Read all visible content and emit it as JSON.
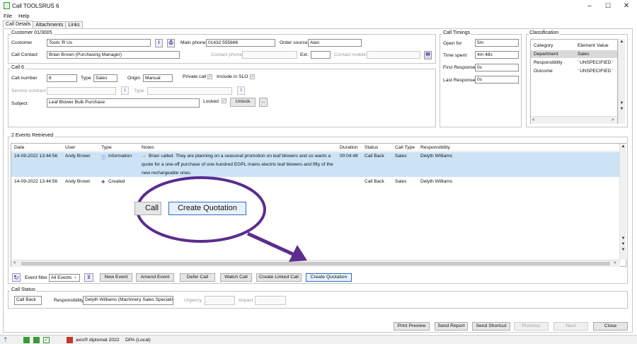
{
  "window": {
    "title": "Call TOOLSRUS 6",
    "minimize": "–",
    "maximize": "☐",
    "close": "✕"
  },
  "menu": [
    "File",
    "Help"
  ],
  "tabs": [
    "Call Details",
    "Attachments",
    "Links"
  ],
  "customer": {
    "group": "Customer 01/3005",
    "customer_label": "Customer",
    "customer_value": "Tools 'R Us",
    "main_phone_label": "Main phone",
    "main_phone_value": "01432 555666",
    "order_source_label": "Order source",
    "order_source_value": "Alan",
    "contact_label": "Call Contact",
    "contact_value": "Brian Brown (Purchasing Manager)",
    "contact_phone_label": "Contact phone",
    "ext_label": "Ext.",
    "contact_mobile_label": "Contact mobile"
  },
  "call": {
    "group": "Call 6",
    "number_label": "Call number",
    "number_value": "6",
    "type_label": "Type",
    "type_value": "Sales",
    "origin_label": "Origin",
    "origin_value": "Manual",
    "private_label": "Private call",
    "slo_label": "Include in SLO",
    "service_label": "Service contract",
    "type2_label": "Type",
    "subject_label": "Subject",
    "subject_value": "Leaf Blower Bulk Purchase",
    "locked_label": "Locked",
    "unlock_label": "Unlock",
    "more_label": "..."
  },
  "timings": {
    "group": "Call Timings",
    "open_label": "Open for",
    "open_value": "5m",
    "spent_label": "Time spent",
    "spent_value": "4m 48s",
    "first_label": "First Response",
    "first_value": "0s",
    "last_label": "Last Response",
    "last_value": "0s"
  },
  "classification": {
    "group": "Classification",
    "headers": [
      "Category",
      "Element Value"
    ],
    "rows": [
      {
        "category": "Department",
        "value": "Sales"
      },
      {
        "category": "Responsibility",
        "value": "' UNSPECIFIED '"
      },
      {
        "category": "Outcome",
        "value": "' UNSPECIFIED '"
      }
    ]
  },
  "events": {
    "group": "2 Events Retrieved",
    "headers": [
      "Date",
      "User",
      "Type",
      "Notes",
      "Duration",
      "Status",
      "Call Type",
      "Responsibility"
    ],
    "rows": [
      {
        "date": "14-09-2022 13:44:56",
        "user": "Andy Brown",
        "type": "Information",
        "notes": [
          "Brian called.  They are planning on a seasonal promotion on leaf blowers and so wants a",
          "quote for a one-off purchase of one hundred EGPL mains electric leaf blowers and fifty of the",
          "new rechargeable ones."
        ],
        "duration": "00:04:48",
        "status": "Call Back",
        "call_type": "Sales",
        "responsibility": "Delyth Williams"
      },
      {
        "date": "14-09-2022 13:44:56",
        "user": "Andy Brown",
        "type": "Created",
        "notes": [],
        "duration": "",
        "status": "Call Back",
        "call_type": "Sales",
        "responsibility": "Delyth Williams"
      }
    ]
  },
  "callout": {
    "partial_button": "Call",
    "button": "Create Quotation"
  },
  "toolbar": {
    "filter_label": "Event filter",
    "filter_value": "All Events",
    "new_event": "New Event",
    "amend_event": "Amend Event",
    "defer_call": "Defer Call",
    "watch_call": "Watch Call",
    "create_linked": "Create Linked Call",
    "create_quotation": "Create Quotation"
  },
  "status": {
    "group": "Call Status",
    "status_value": "Call Back",
    "responsibility_label": "Responsibility",
    "responsibility_value": "Delyth Williams (Machinery Sales Specialist)",
    "urgency_label": "Urgency",
    "impact_label": "Impact"
  },
  "footer_buttons": {
    "print": "Print Preview",
    "send_report": "Send Report",
    "send_shortcut": "Send Shortcut",
    "previous": "Previous",
    "next": "Next",
    "close": "Close"
  },
  "statusbar": {
    "app": "axis® diplomat 2022",
    "db": "DPA (Local)"
  },
  "colors": {
    "accent": "#2a6fc4",
    "selection": "#cce3f6",
    "callout": "#5b2d8e"
  }
}
